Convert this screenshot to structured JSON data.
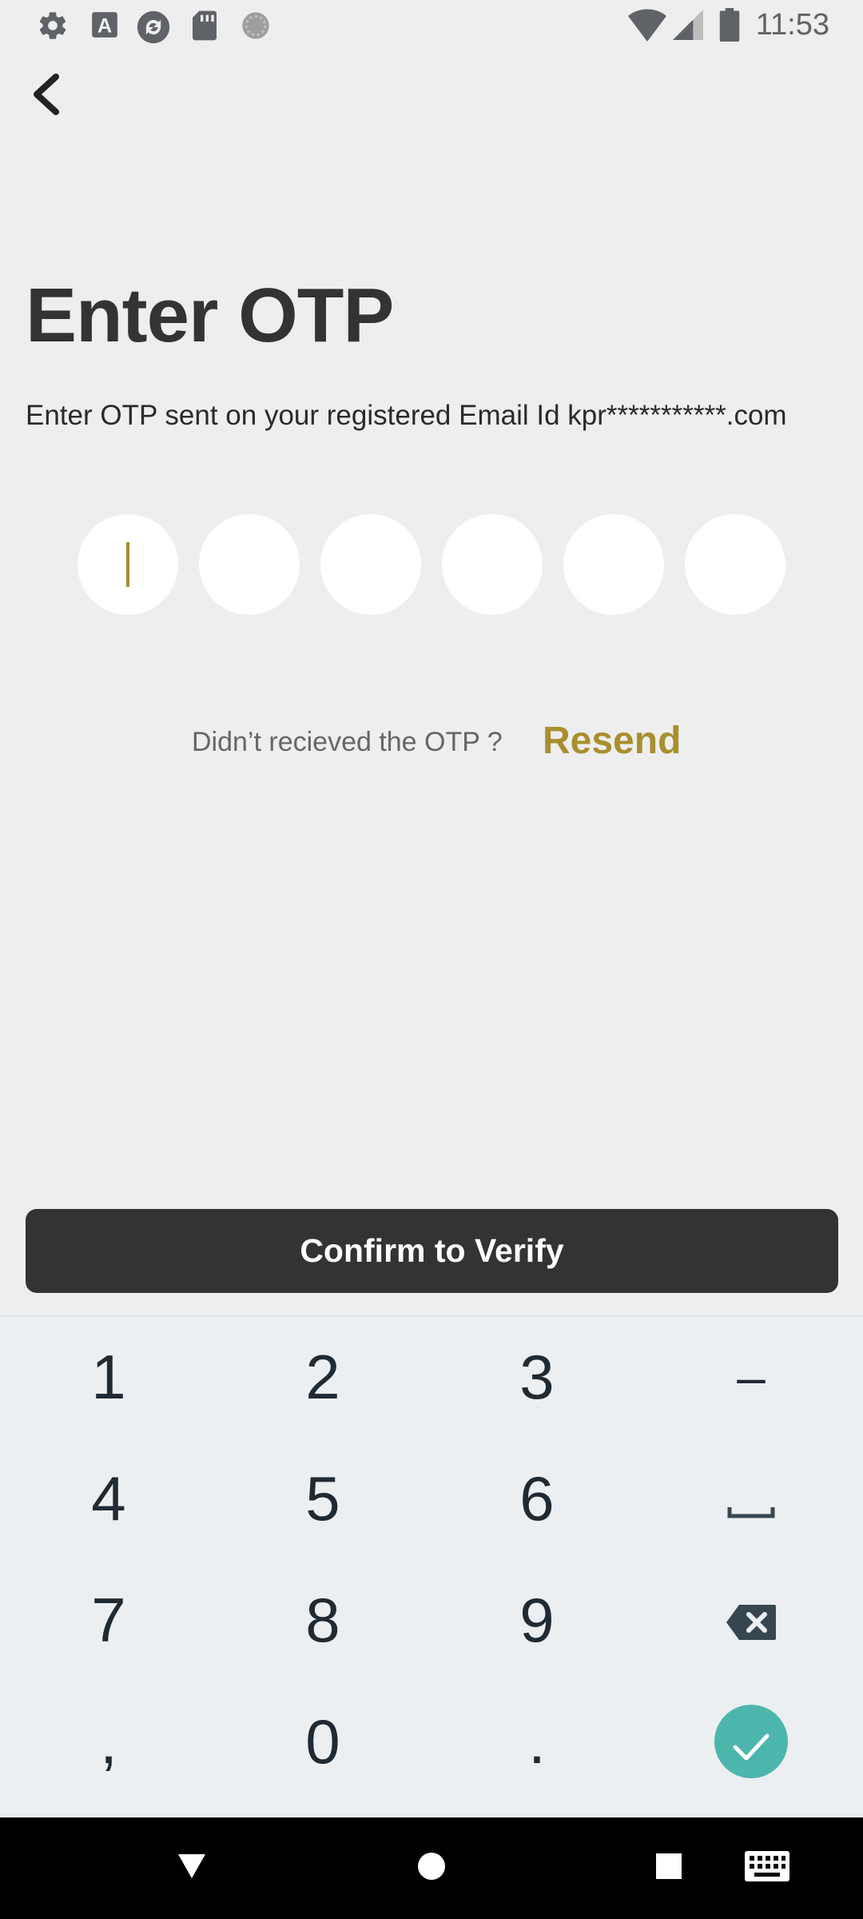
{
  "status_bar": {
    "time": "11:53",
    "left_icons": [
      "settings-icon",
      "app-a-icon",
      "sync-icon",
      "sd-card-icon",
      "loading-circle-icon"
    ],
    "right_icons": [
      "wifi-icon",
      "signal-icon",
      "battery-icon"
    ]
  },
  "header": {
    "back_icon": "chevron-left-icon"
  },
  "main": {
    "title": "Enter OTP",
    "subtitle": "Enter OTP sent on your registered Email Id kpr***********.com",
    "otp_digits": [
      "",
      "",
      "",
      "",
      "",
      ""
    ],
    "resend_question": "Didn’t recieved the OTP ?",
    "resend_label": "Resend",
    "confirm_label": "Confirm to Verify"
  },
  "keyboard": {
    "rows": [
      [
        "1",
        "2",
        "3",
        "–"
      ],
      [
        "4",
        "5",
        "6",
        "space"
      ],
      [
        "7",
        "8",
        "9",
        "backspace"
      ],
      [
        ",",
        "0",
        ".",
        "enter"
      ]
    ],
    "labels": {
      "k1": "1",
      "k2": "2",
      "k3": "3",
      "kdash": "–",
      "k4": "4",
      "k5": "5",
      "k6": "6",
      "k7": "7",
      "k8": "8",
      "k9": "9",
      "kcomma": ",",
      "k0": "0",
      "kdot": "."
    }
  },
  "nav_bar": {
    "icons": [
      "back-triangle-icon",
      "home-circle-icon",
      "recents-square-icon",
      "keyboard-icon"
    ]
  },
  "colors": {
    "accent": "#a88f2e",
    "button_dark": "#333333",
    "background": "#eeeeee",
    "keyboard_bg": "#eceff1",
    "enter_key": "#4db6ac"
  }
}
